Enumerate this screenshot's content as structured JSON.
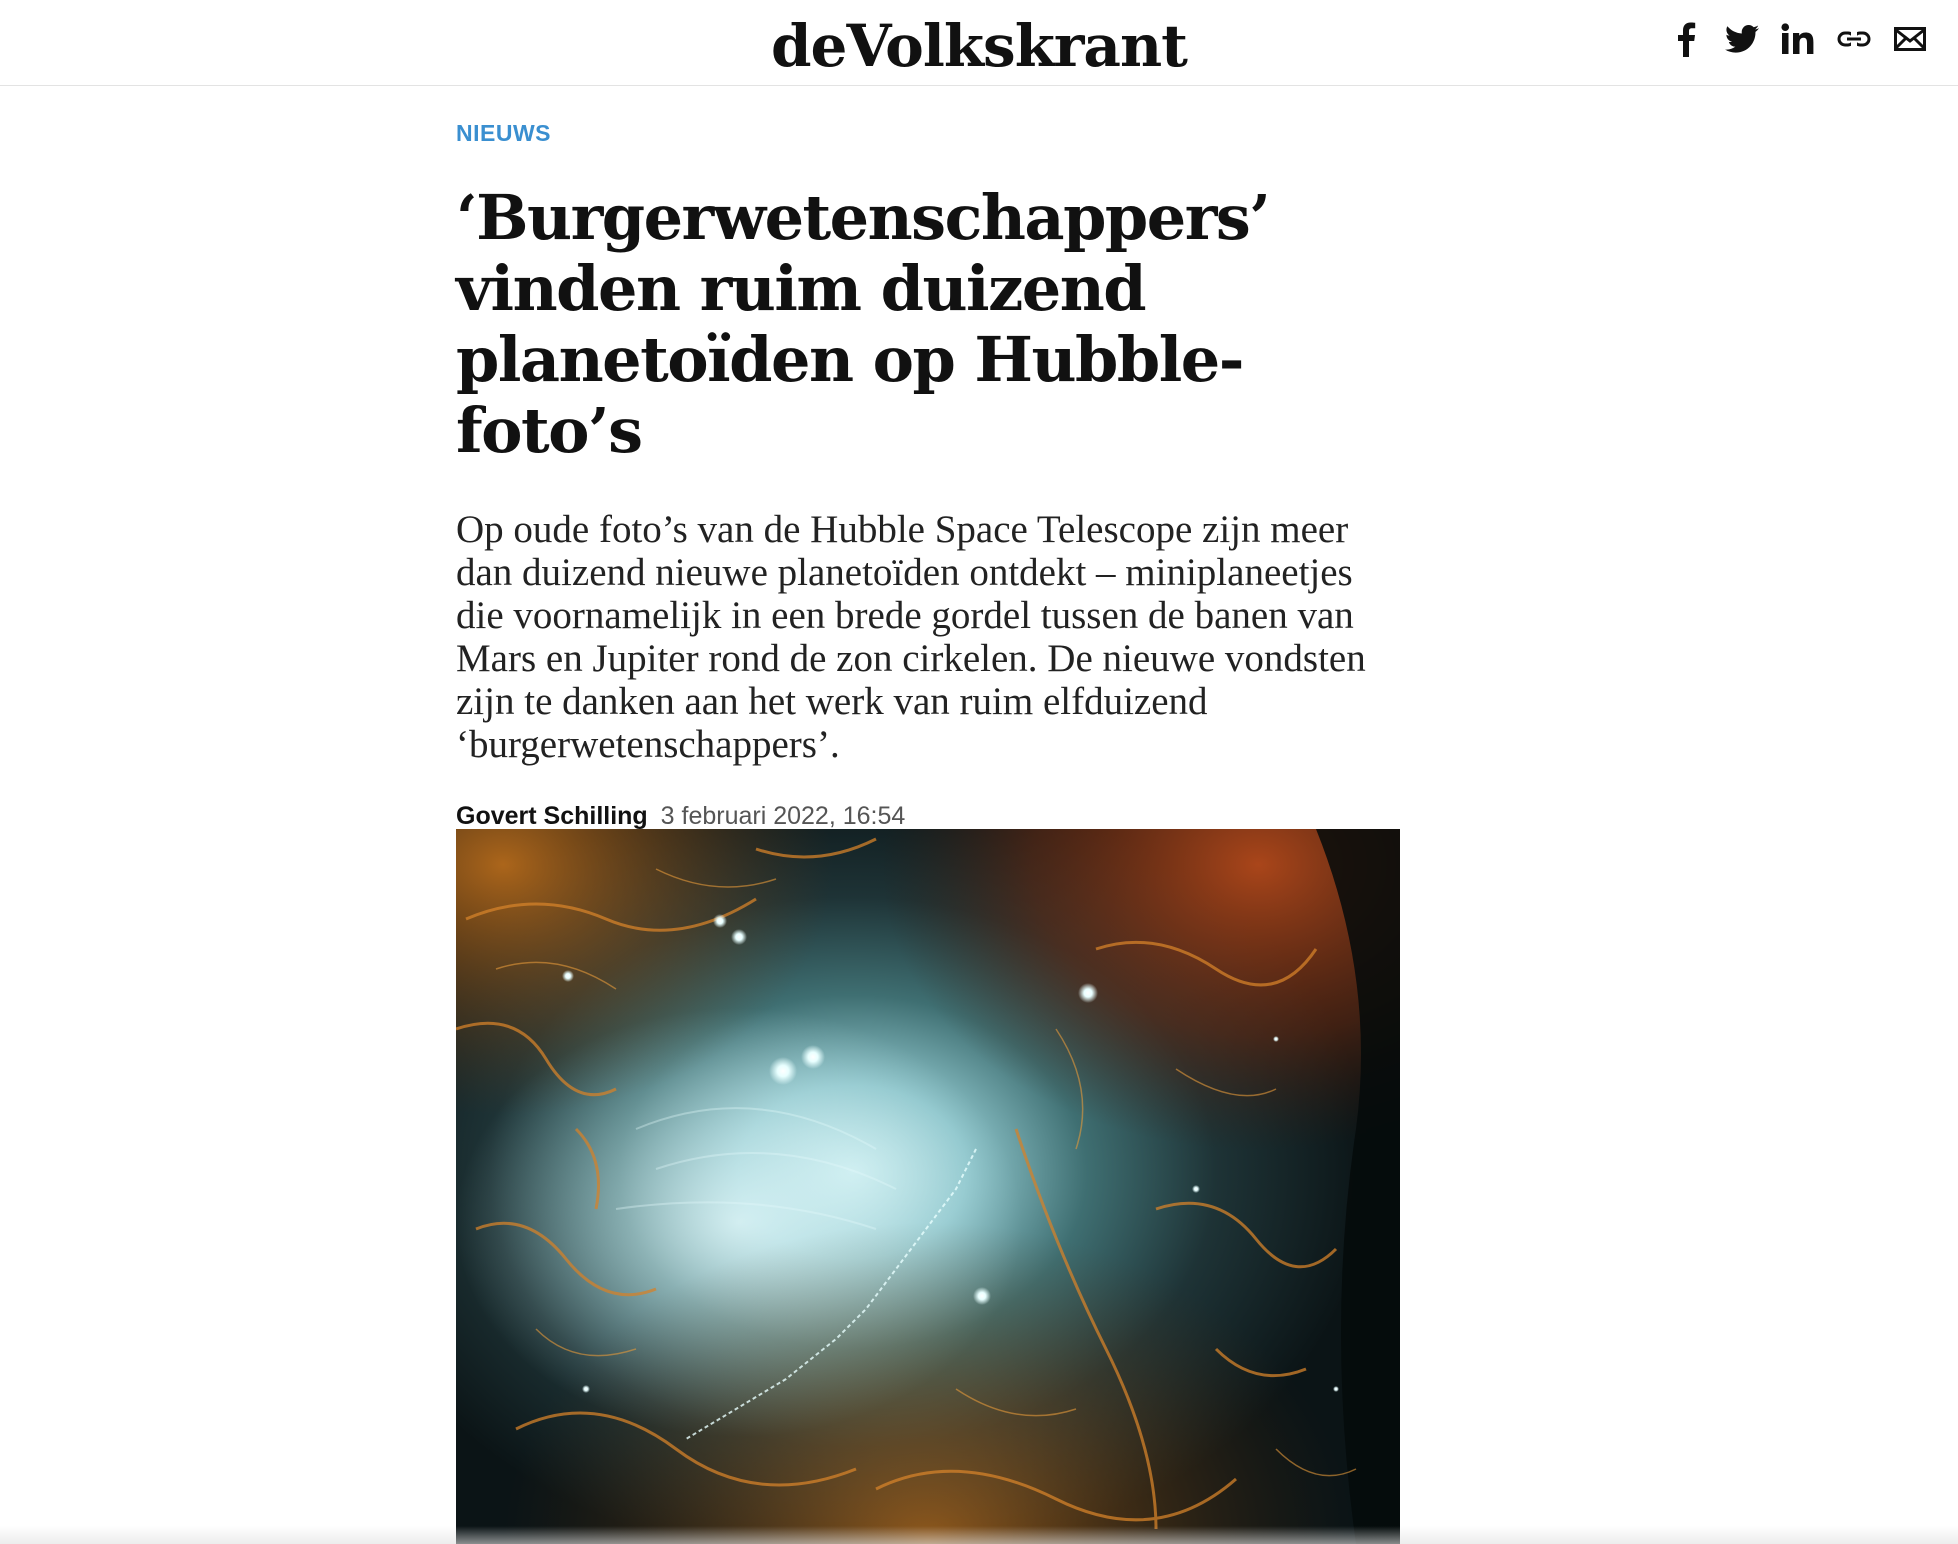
{
  "header": {
    "logo_text": "deVolkskrant",
    "share_buttons": [
      {
        "icon": "facebook-icon"
      },
      {
        "icon": "twitter-icon"
      },
      {
        "icon": "linkedin-icon"
      },
      {
        "icon": "link-icon"
      },
      {
        "icon": "mail-icon"
      }
    ]
  },
  "article": {
    "section": "NIEUWS",
    "headline": "‘Burgerwetenschappers’ vinden ruim duizend planetoïden op Hubble-foto’s",
    "lead": "Op oude foto’s van de Hubble Space Telescope zijn meer dan duizend nieuwe planetoïden ontdekt – miniplaneetjes die voornamelijk in een brede gordel tussen de banen van Mars en Jupiter rond de zon cirkelen. De nieuwe vondsten zijn te danken aan het werk van ruim elfduizend ‘burgerwetenschappers’.",
    "author": "Govert Schilling",
    "date": "3 februari 2022, 16:54"
  },
  "hero_image": {
    "subject": "Hubble image of a nebula with an asteroid trail",
    "accent_colors": {
      "nebula_blue": "#bfe6ea",
      "filament_orange": "#c8741c",
      "background": "#0a1418"
    }
  },
  "colors": {
    "section_label": "#3a8fd0",
    "text": "#111111"
  }
}
